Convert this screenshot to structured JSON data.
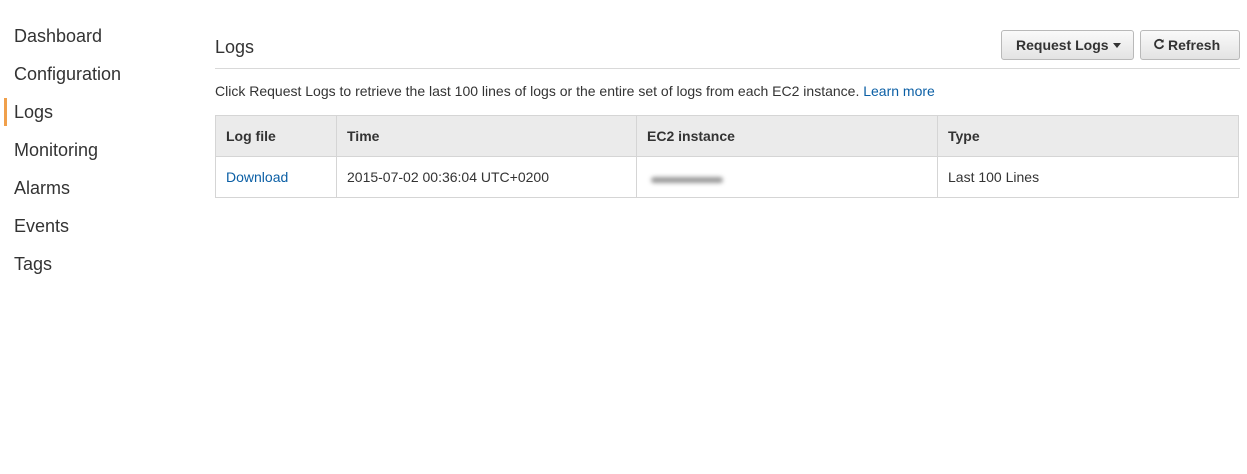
{
  "sidebar": {
    "items": [
      {
        "label": "Dashboard",
        "active": false
      },
      {
        "label": "Configuration",
        "active": false
      },
      {
        "label": "Logs",
        "active": true
      },
      {
        "label": "Monitoring",
        "active": false
      },
      {
        "label": "Alarms",
        "active": false
      },
      {
        "label": "Events",
        "active": false
      },
      {
        "label": "Tags",
        "active": false
      }
    ],
    "accent_color": "#f0a04b"
  },
  "header": {
    "title": "Logs",
    "request_logs_label": "Request Logs",
    "refresh_label": "Refresh"
  },
  "info": {
    "text": "Click Request Logs to retrieve the last 100 lines of logs or the entire set of logs from each EC2 instance.",
    "learn_more": "Learn more"
  },
  "table": {
    "columns": [
      "Log file",
      "Time",
      "EC2 instance",
      "Type"
    ],
    "rows": [
      {
        "log_file": "Download",
        "time": "2015-07-02 00:36:04 UTC+0200",
        "ec2_instance": "",
        "type": "Last 100 Lines"
      }
    ]
  },
  "colors": {
    "link": "#0b5fa5",
    "header_bg": "#ebebeb",
    "border": "#d5d5d5"
  }
}
